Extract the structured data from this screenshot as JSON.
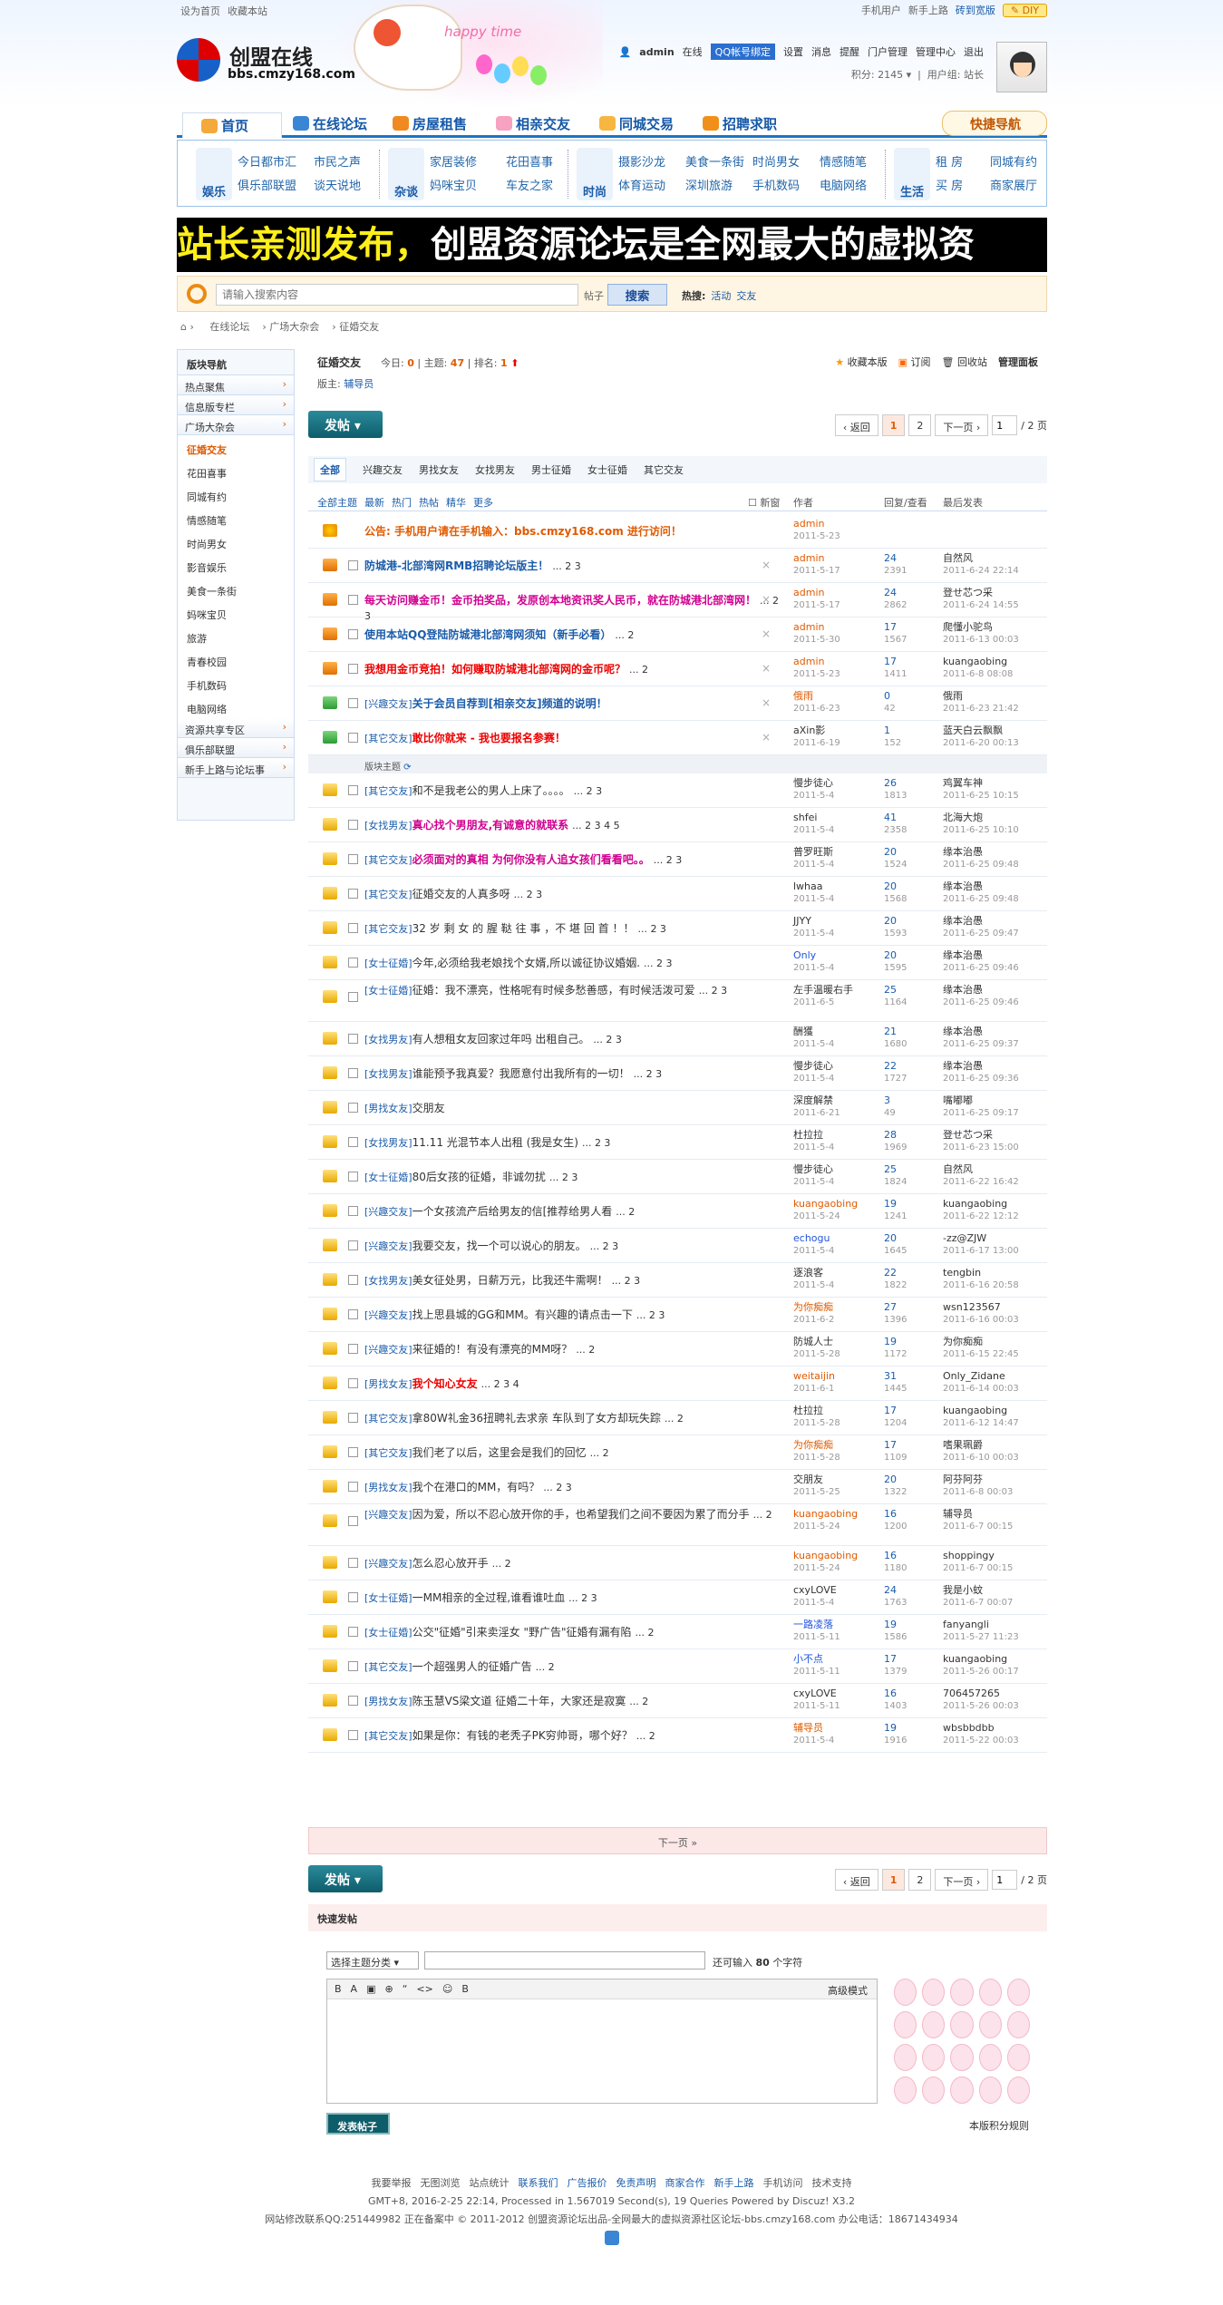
{
  "topbar": {
    "left": [
      "设为首页",
      "收藏本站"
    ],
    "right": [
      "手机用户",
      "新手上路",
      "砖到宽版"
    ],
    "diy": "DIY"
  },
  "logo": {
    "name": "创盟在线",
    "domain": "bbs.cmzy168.com"
  },
  "banner": {
    "text": "happy time"
  },
  "user": {
    "name": "admin",
    "status": "在线",
    "qq": "QQ帐号绑定",
    "links": [
      "设置",
      "消息",
      "提醒",
      "门户管理",
      "管理中心",
      "退出"
    ],
    "points": "积分: 2145",
    "group": "用户组: 站长"
  },
  "nav": {
    "items": [
      "首页",
      "在线论坛",
      "房屋租售",
      "相亲交友",
      "同城交易",
      "招聘求职"
    ],
    "quick": "快捷导航"
  },
  "cats": [
    {
      "label": "娱乐",
      "links": [
        "今日都市汇",
        "市民之声",
        "俱乐部联盟",
        "谈天说地"
      ]
    },
    {
      "label": "杂谈",
      "links": [
        "家居装修",
        "花田喜事",
        "妈咪宝贝",
        "车友之家"
      ]
    },
    {
      "label": "时尚",
      "links": [
        "摄影沙龙",
        "美食一条街",
        "时尚男女",
        "情感随笔",
        "体育运动",
        "深圳旅游",
        "手机数码",
        "电脑网络"
      ]
    },
    {
      "label": "生活",
      "links": [
        "租 房",
        "同城有约",
        "买 房",
        "商家展厅"
      ]
    }
  ],
  "ad": {
    "yellow": "站长亲测发布，",
    "white": "创盟资源论坛是全网最大的虚拟资"
  },
  "search": {
    "placeholder": "请输入搜索内容",
    "opt": "帖子",
    "btn": "搜索",
    "hot_label": "热搜:",
    "hot": [
      "活动",
      "交友"
    ]
  },
  "crumb": [
    "在线论坛",
    "广场大杂会",
    "征婚交友"
  ],
  "side": {
    "title": "版块导航",
    "groups": [
      "热点聚焦",
      "信息版专栏",
      "广场大杂会"
    ],
    "subs": [
      "征婚交友",
      "花田喜事",
      "同城有约",
      "情感随笔",
      "时尚男女",
      "影音娱乐",
      "美食一条街",
      "妈咪宝贝",
      "旅游",
      "青春校园",
      "手机数码",
      "电脑网络"
    ],
    "groups2": [
      "资源共享专区",
      "俱乐部联盟",
      "新手上路与论坛事"
    ]
  },
  "forum": {
    "title": "征婚交友",
    "today_label": "今日:",
    "today": "0",
    "topics_label": "主题:",
    "topics": "47",
    "rank_label": "排名:",
    "rank": "1",
    "mods_label": "版主:",
    "mods": "辅导员",
    "acts": [
      "收藏本版",
      "订阅",
      "回收站",
      "管理面板"
    ]
  },
  "post_btn": "发帖",
  "pager": {
    "back": "‹ 返回",
    "pages": [
      "1",
      "2"
    ],
    "next": "下一页 ›",
    "val": "1",
    "total": "/ 2 页"
  },
  "tabs": [
    "全部",
    "兴趣交友",
    "男找女友",
    "女找男友",
    "男士征婚",
    "女士征婚",
    "其它交友"
  ],
  "th": {
    "filters": [
      "全部主题",
      "最新",
      "热门",
      "热帖",
      "精华",
      "更多"
    ],
    "new": "新窗",
    "author": "作者",
    "count": "回复/查看",
    "last": "最后发表"
  },
  "sep_label": "版块主题",
  "sticky": [
    {
      "ic": "an",
      "cls": "ann",
      "title": "公告: 手机用户请在手机输入：bbs.cmzy168.com 进行访问！",
      "pg": "",
      "au": "admin",
      "d": "2011-5-23",
      "r": "",
      "v": "",
      "lu": "",
      "ld": ""
    },
    {
      "ic": "up",
      "cls": "blue",
      "title": "防城港-北部湾网RMB招聘论坛版主！",
      "pg": "... 2 3",
      "au": "admin",
      "d": "2011-5-17",
      "r": "24",
      "v": "2391",
      "lu": "自然风",
      "ld": "2011-6-24 22:14"
    },
    {
      "ic": "up",
      "cls": "pink",
      "title": "每天访问赚金币！金币拍奖品，发原创本地资讯奖人民币，就在防城港北部湾网！",
      "pg": "... 2 3",
      "au": "admin",
      "d": "2011-5-17",
      "r": "24",
      "v": "2862",
      "lu": "登せ芯つ采",
      "ld": "2011-6-24 14:55"
    },
    {
      "ic": "up",
      "cls": "blue",
      "title": "使用本站QQ登陆防城港北部湾网须知（新手必看）",
      "pg": "... 2",
      "au": "admin",
      "d": "2011-5-30",
      "r": "17",
      "v": "1567",
      "lu": "爬懂小驼鸟",
      "ld": "2011-6-13 00:03"
    },
    {
      "ic": "up",
      "cls": "red",
      "title": "我想用金币竞拍！如何赚取防城港北部湾网的金币呢？",
      "pg": "... 2",
      "au": "admin",
      "d": "2011-5-23",
      "r": "17",
      "v": "1411",
      "lu": "kuangaobing",
      "ld": "2011-6-8 08:08"
    },
    {
      "ic": "gr",
      "cls": "blue",
      "ty": "[兴趣交友]",
      "title": "关于会员自荐到[相亲交友]频道的说明！",
      "pg": "",
      "au": "俄雨",
      "d": "2011-6-23",
      "r": "0",
      "v": "42",
      "lu": "俄雨",
      "ld": "2011-6-23 21:42"
    },
    {
      "ic": "gr",
      "cls": "red",
      "ty": "[其它交友]",
      "title": "敢比你就来 - 我也要报名参赛！",
      "pg": "",
      "au": "aXin影",
      "d": "2011-6-19",
      "r": "1",
      "v": "152",
      "lu": "蓝天白云飘飘",
      "ld": "2011-6-20 00:13"
    }
  ],
  "threads": [
    {
      "ty": "[其它交友]",
      "title": "和不是我老公的男人上床了。。。。",
      "pg": "... 2 3",
      "au": "慢步徒心",
      "d": "2011-5-4",
      "r": "26",
      "v": "1813",
      "lu": "鸡翼车神",
      "ld": "2011-6-25 10:15"
    },
    {
      "ty": "[女找男友]",
      "title": "真心找个男朋友,有诚意的就联系",
      "pg": "... 2 3 4 5",
      "au": "shfei",
      "d": "2011-5-4",
      "r": "41",
      "v": "2358",
      "lu": "北海大炮",
      "ld": "2011-6-25 10:10",
      "cls": "pink"
    },
    {
      "ty": "[其它交友]",
      "title": "必须面对的真相 为何你没有人追女孩们看看吧。。",
      "pg": "... 2 3",
      "au": "普罗旺斯",
      "d": "2011-5-4",
      "r": "20",
      "v": "1524",
      "lu": "缘本治愚",
      "ld": "2011-6-25 09:48",
      "cls": "pink"
    },
    {
      "ty": "[其它交友]",
      "title": "征婚交友的人真多呀",
      "pg": "... 2 3",
      "au": "lwhaa",
      "d": "2011-5-4",
      "r": "20",
      "v": "1568",
      "lu": "缘本治愚",
      "ld": "2011-6-25 09:48"
    },
    {
      "ty": "[其它交友]",
      "title": "32 岁 剩 女 的 腥 鞑 往 事 ，不 堪 回 首 ！！",
      "pg": "... 2 3",
      "au": "JJYY",
      "d": "2011-5-4",
      "r": "20",
      "v": "1593",
      "lu": "缘本治愚",
      "ld": "2011-6-25 09:47"
    },
    {
      "ty": "[女士征婚]",
      "title": "今年,必须给我老娘找个女婿,所以诚征协议婚姻.",
      "pg": "... 2 3",
      "au": "Only",
      "d": "2011-5-4",
      "r": "20",
      "v": "1595",
      "lu": "缘本治愚",
      "ld": "2011-6-25 09:46"
    },
    {
      "ty": "[女士征婚]",
      "title": "征婚：我不漂亮，性格呢有时候多愁善感，有时候活泼可爱",
      "pg": "... 2 3",
      "au": "左手温暖右手",
      "d": "2011-6-5",
      "r": "25",
      "v": "1164",
      "lu": "缘本治愚",
      "ld": "2011-6-25 09:46",
      "two": true
    },
    {
      "ty": "[女找男友]",
      "title": "有人想租女友回家过年吗 出租自己。",
      "pg": "... 2 3",
      "au": "酬獲",
      "d": "2011-5-4",
      "r": "21",
      "v": "1680",
      "lu": "缘本治愚",
      "ld": "2011-6-25 09:37"
    },
    {
      "ty": "[女找男友]",
      "title": "谁能预予我真爱？我愿意付出我所有的一切！",
      "pg": "... 2 3",
      "au": "慢步徒心",
      "d": "2011-5-4",
      "r": "22",
      "v": "1727",
      "lu": "缘本治愚",
      "ld": "2011-6-25 09:36"
    },
    {
      "ty": "[男找女友]",
      "title": "交朋友",
      "pg": "",
      "au": "深度解禁",
      "d": "2011-6-21",
      "r": "3",
      "v": "49",
      "lu": "嘴嘟嘟",
      "ld": "2011-6-25 09:17"
    },
    {
      "ty": "[女找男友]",
      "title": "11.11 光混节本人出租 (我是女生)",
      "pg": "... 2 3",
      "au": "杜拉拉",
      "d": "2011-5-4",
      "r": "28",
      "v": "1969",
      "lu": "登せ芯つ采",
      "ld": "2011-6-23 15:00"
    },
    {
      "ty": "[女士征婚]",
      "title": "80后女孩的征婚，非诚勿扰",
      "pg": "... 2 3",
      "au": "慢步徒心",
      "d": "2011-5-4",
      "r": "25",
      "v": "1824",
      "lu": "自然风",
      "ld": "2011-6-22 16:42"
    },
    {
      "ty": "[兴趣交友]",
      "title": "一个女孩流产后给男友的信[推荐给男人看",
      "pg": "... 2",
      "au": "kuangaobing",
      "d": "2011-5-24",
      "r": "19",
      "v": "1241",
      "lu": "kuangaobing",
      "ld": "2011-6-22 12:12"
    },
    {
      "ty": "[兴趣交友]",
      "title": "我要交友，找一个可以说心的朋友。",
      "pg": "... 2 3",
      "au": "echogu",
      "d": "2011-5-4",
      "r": "20",
      "v": "1645",
      "lu": "-zz@ZJW",
      "ld": "2011-6-17 13:00"
    },
    {
      "ty": "[女找男友]",
      "title": "美女征处男，日薪万元，比我还牛需啊！",
      "pg": "... 2 3",
      "au": "逐浪客",
      "d": "2011-5-4",
      "r": "22",
      "v": "1822",
      "lu": "tengbin",
      "ld": "2011-6-16 20:58"
    },
    {
      "ty": "[兴趣交友]",
      "title": "找上思县城的GG和MM。有兴趣的请点击一下",
      "pg": "... 2 3",
      "au": "为你痴痴",
      "d": "2011-6-2",
      "r": "27",
      "v": "1396",
      "lu": "wsn123567",
      "ld": "2011-6-16 00:03"
    },
    {
      "ty": "[兴趣交友]",
      "title": "来征婚的！有没有漂亮的MM呀？",
      "pg": "... 2",
      "au": "防城人士",
      "d": "2011-5-28",
      "r": "19",
      "v": "1172",
      "lu": "为你痴痴",
      "ld": "2011-6-15 22:45"
    },
    {
      "ty": "[男找女友]",
      "title": "我个知心女友",
      "pg": "... 2 3 4",
      "au": "weitaijin",
      "d": "2011-6-1",
      "r": "31",
      "v": "1445",
      "lu": "Only_Zidane",
      "ld": "2011-6-14 00:03",
      "cls": "red"
    },
    {
      "ty": "[其它交友]",
      "title": "拿80W礼金36扭聘礼去求亲 车队到了女方却玩失踪",
      "pg": "... 2",
      "au": "杜拉拉",
      "d": "2011-5-28",
      "r": "17",
      "v": "1204",
      "lu": "kuangaobing",
      "ld": "2011-6-12 14:47"
    },
    {
      "ty": "[其它交友]",
      "title": "我们老了以后，这里会是我们的回忆",
      "pg": "... 2",
      "au": "为你痴痴",
      "d": "2011-5-28",
      "r": "17",
      "v": "1109",
      "lu": "嗜果珮爵",
      "ld": "2011-6-10 00:03"
    },
    {
      "ty": "[男找女友]",
      "title": "我个在港口的MM，有吗？",
      "pg": "... 2 3",
      "au": "交朋友",
      "d": "2011-5-25",
      "r": "20",
      "v": "1322",
      "lu": "阿芬阿芬",
      "ld": "2011-6-8 00:03"
    },
    {
      "ty": "[兴趣交友]",
      "title": "因为爱，所以不忍心放开你的手，也希望我们之间不要因为累了而分手",
      "pg": "... 2",
      "au": "kuangaobing",
      "d": "2011-5-24",
      "r": "16",
      "v": "1200",
      "lu": "辅导员",
      "ld": "2011-6-7 00:15",
      "two": true
    },
    {
      "ty": "[兴趣交友]",
      "title": "怎么忍心放开手",
      "pg": "... 2",
      "au": "kuangaobing",
      "d": "2011-5-24",
      "r": "16",
      "v": "1180",
      "lu": "shoppingy",
      "ld": "2011-6-7 00:15"
    },
    {
      "ty": "[女士征婚]",
      "title": "一MM相亲的全过程,谁看谁吐血",
      "pg": "... 2 3",
      "au": "cxyLOVE",
      "d": "2011-5-4",
      "r": "24",
      "v": "1763",
      "lu": "我是小蚊",
      "ld": "2011-6-7 00:07"
    },
    {
      "ty": "[女士征婚]",
      "title": "公交\"征婚\"引来卖淫女 \"野广告\"征婚有漏有陷",
      "pg": "... 2",
      "au": "一路凌落",
      "d": "2011-5-11",
      "r": "19",
      "v": "1586",
      "lu": "fanyangli",
      "ld": "2011-5-27 11:23"
    },
    {
      "ty": "[其它交友]",
      "title": "一个超强男人的征婚广告",
      "pg": "... 2",
      "au": "小不点",
      "d": "2011-5-11",
      "r": "17",
      "v": "1379",
      "lu": "kuangaobing",
      "ld": "2011-5-26 00:17"
    },
    {
      "ty": "[男找女友]",
      "title": "陈玉慧VS梁文道 征婚二十年，大家还是寂寞",
      "pg": "... 2",
      "au": "cxyLOVE",
      "d": "2011-5-11",
      "r": "16",
      "v": "1403",
      "lu": "706457265",
      "ld": "2011-5-26 00:03"
    },
    {
      "ty": "[其它交友]",
      "title": "如果是你：有钱的老秃子PK穷帅哥，哪个好？",
      "pg": "... 2",
      "au": "辅导员",
      "d": "2011-5-4",
      "r": "19",
      "v": "1916",
      "lu": "wbsbbdbb",
      "ld": "2011-5-22 00:03"
    }
  ],
  "next_bar": "下一页 »",
  "quick_post": {
    "title": "快速发帖",
    "sel": "选择主题分类",
    "tip_pre": "还可输入",
    "tip_num": "80",
    "tip_post": "个字符",
    "adv": "高级模式",
    "send": "发表帖子",
    "rule": "本版积分规则",
    "tools": [
      "B",
      "A",
      "▣",
      "⊕",
      "“",
      "<>",
      "☺",
      "B"
    ]
  },
  "footer": {
    "links": [
      "我要举报",
      "无图浏览",
      "站点统计",
      "联系我们",
      "广告报价",
      "免责声明",
      "商家合作",
      "新手上路",
      "手机访问",
      "技术支持"
    ],
    "line2": "GMT+8, 2016-2-25 22:14, Processed in 1.567019 Second(s), 19 Queries Powered by Discuz! X3.2",
    "line3": "网站修改联系QQ:251449982 正在备案中 © 2011-2012 创盟资源论坛出品-全网最大的虚拟资源社区论坛-bbs.cmzy168.com 办公电话：18671434934"
  },
  "colors": {
    "accent": "#1b76c4",
    "brand": "#e05a00",
    "post": "#0e5d6b"
  }
}
